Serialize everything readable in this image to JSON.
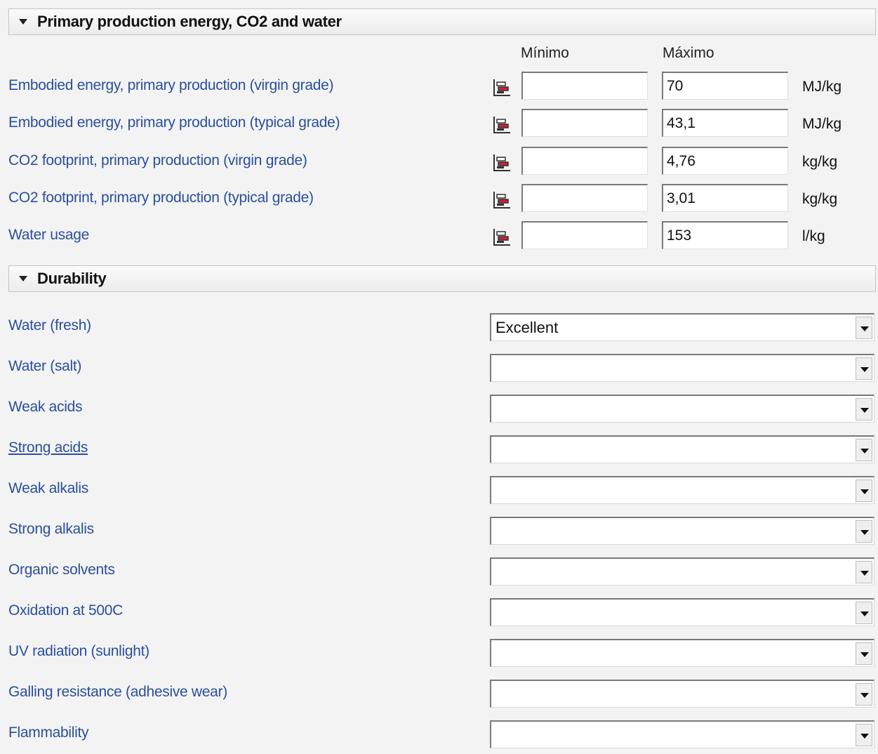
{
  "primary": {
    "title": "Primary production energy, CO2 and water",
    "col_min": "Mínimo",
    "col_max": "Máximo",
    "rows": [
      {
        "label": "Embodied energy, primary production (virgin grade)",
        "min": "",
        "max": "70",
        "unit": "MJ/kg"
      },
      {
        "label": "Embodied energy, primary production (typical grade)",
        "min": "",
        "max": "43,1",
        "unit": "MJ/kg"
      },
      {
        "label": "CO2 footprint, primary production (virgin grade)",
        "min": "",
        "max": "4,76",
        "unit": "kg/kg"
      },
      {
        "label": "CO2 footprint, primary production (typical grade)",
        "min": "",
        "max": "3,01",
        "unit": "kg/kg"
      },
      {
        "label": "Water usage",
        "min": "",
        "max": "153",
        "unit": "l/kg"
      }
    ]
  },
  "durability": {
    "title": "Durability",
    "rows": [
      {
        "label": "Water (fresh)",
        "value": "Excellent"
      },
      {
        "label": "Water (salt)",
        "value": ""
      },
      {
        "label": "Weak acids",
        "value": ""
      },
      {
        "label": "Strong acids",
        "value": ""
      },
      {
        "label": "Weak alkalis",
        "value": ""
      },
      {
        "label": "Strong alkalis",
        "value": ""
      },
      {
        "label": "Organic solvents",
        "value": ""
      },
      {
        "label": "Oxidation at 500C",
        "value": ""
      },
      {
        "label": "UV radiation (sunlight)",
        "value": ""
      },
      {
        "label": "Galling resistance (adhesive wear)",
        "value": ""
      },
      {
        "label": "Flammability",
        "value": ""
      }
    ]
  },
  "colors": {
    "label_blue": "#2a4f9c",
    "background": "#f3f3f3"
  }
}
